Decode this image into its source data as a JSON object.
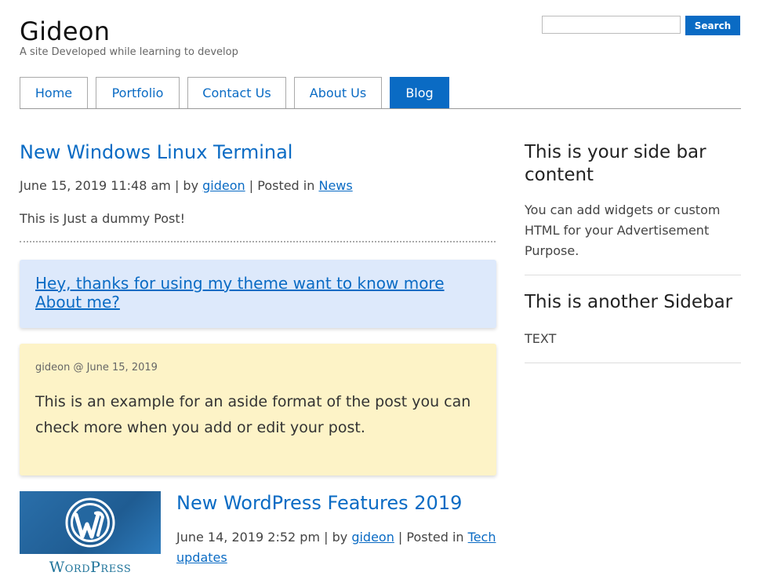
{
  "header": {
    "site_title": "Gideon",
    "tagline": "A site Developed while learning to develop",
    "search": {
      "value": "",
      "placeholder": "",
      "button_label": "Search"
    }
  },
  "nav": {
    "items": [
      {
        "label": "Home"
      },
      {
        "label": "Portfolio"
      },
      {
        "label": "Contact Us"
      },
      {
        "label": "About Us"
      },
      {
        "label": "Blog",
        "active": true
      }
    ]
  },
  "posts": {
    "first": {
      "title": "New Windows Linux Terminal",
      "date": "June 15, 2019 11:48 am",
      "by_text": " | by ",
      "author": "gideon",
      "posted_in_text": " | Posted in ",
      "category": "News",
      "excerpt": "This is Just a dummy Post!"
    },
    "link_box": {
      "text": "Hey, thanks for using my theme want to know more About me?"
    },
    "aside": {
      "meta": "gideon @ June 15, 2019",
      "text": "This is an example for an aside format of the post you can check more when you add or edit your post."
    },
    "second": {
      "title": "New WordPress Features 2019",
      "date": "June 14, 2019 2:52 pm",
      "by_text": " | by ",
      "author": "gideon",
      "posted_in_text": " | Posted in ",
      "category": "Tech updates",
      "thumbnail_text": "WordPress"
    }
  },
  "sidebar": {
    "widget1": {
      "heading": "This is your side bar content",
      "text": "You can add widgets or custom HTML for your Advertisement Purpose."
    },
    "widget2": {
      "heading": "This is another Sidebar",
      "text": "TEXT"
    }
  },
  "colors": {
    "accent": "#0a6bc4",
    "link_box_bg": "#dde9fb",
    "aside_bg": "#fdf3c7"
  }
}
